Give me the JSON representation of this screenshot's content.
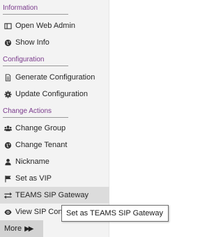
{
  "menu": {
    "sections": {
      "information": "Information",
      "configuration": "Configuration",
      "change_actions": "Change Actions"
    },
    "items": {
      "open_web_admin": {
        "label": "Open Web Admin",
        "icon": "window-icon"
      },
      "show_info": {
        "label": "Show Info",
        "icon": "globe-icon"
      },
      "generate_configuration": {
        "label": "Generate Configuration",
        "icon": "document-icon"
      },
      "update_configuration": {
        "label": "Update Configuration",
        "icon": "gear-icon"
      },
      "change_group": {
        "label": "Change Group",
        "icon": "users-icon"
      },
      "change_tenant": {
        "label": "Change Tenant",
        "icon": "globe-icon"
      },
      "nickname": {
        "label": "Nickname",
        "icon": "user-icon"
      },
      "set_as_vip": {
        "label": "Set as VIP",
        "icon": "flag-icon"
      },
      "teams_sip_gateway": {
        "label": "TEAMS SIP Gateway",
        "icon": "exchange-icon"
      },
      "view_sip": {
        "label": "View SIP Con",
        "icon": "eye-icon"
      }
    },
    "more": {
      "label": "More",
      "icon": "double-chevron-right-icon"
    }
  },
  "tooltip": {
    "text": "Set as TEAMS SIP Gateway"
  },
  "colors": {
    "section_header": "#7a3a8c",
    "menu_bg": "#f3f3f3",
    "active_bg": "#dcdcdc",
    "more_bg": "#d3d3d3"
  }
}
